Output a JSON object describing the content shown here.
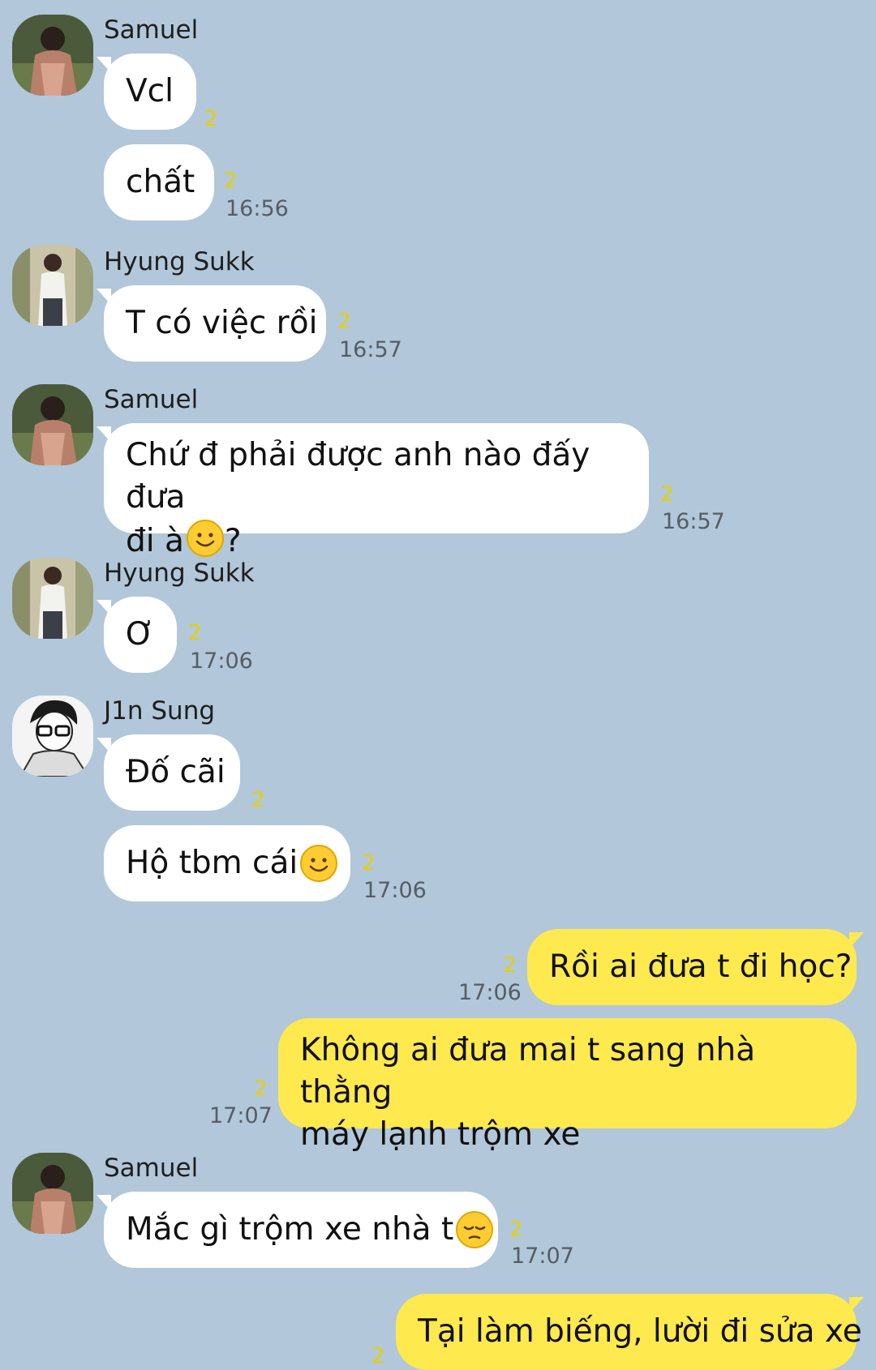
{
  "participants": {
    "samuel": "Samuel",
    "hyung_sukk": "Hyung Sukk",
    "j1n_sung": "J1n Sung"
  },
  "messages": [
    {
      "sender": "Samuel",
      "text": "Vcl",
      "unread": "2",
      "time": ""
    },
    {
      "sender": "",
      "text": "chất",
      "unread": "2",
      "time": "16:56"
    },
    {
      "sender": "Hyung Sukk",
      "text": "T có việc rồi",
      "unread": "2",
      "time": "16:57"
    },
    {
      "sender": "Samuel",
      "text_line1": "Chứ đ phải được anh nào đấy đưa",
      "text_line2_before": "đi à",
      "text_line2_after": "?",
      "emoji": "smile-emoji",
      "unread": "2",
      "time": "16:57"
    },
    {
      "sender": "Hyung Sukk",
      "text": "Ơ",
      "unread": "2",
      "time": "17:06"
    },
    {
      "sender": "J1n Sung",
      "text": "Đố cãi",
      "unread": "2",
      "time": ""
    },
    {
      "sender": "",
      "text": "Hộ tbm cái",
      "emoji": "smile-emoji",
      "unread": "2",
      "time": "17:06"
    },
    {
      "sender": "me",
      "text": "Rồi ai đưa t đi học?",
      "unread": "2",
      "time": "17:06"
    },
    {
      "sender": "me",
      "text_line1": "Không ai đưa mai t sang nhà thằng",
      "text_line2": "máy lạnh trộm xe",
      "unread": "2",
      "time": "17:07"
    },
    {
      "sender": "Samuel",
      "text": "Mắc gì trộm xe nhà t",
      "emoji": "pensive-emoji",
      "unread": "2",
      "time": "17:07"
    },
    {
      "sender": "me",
      "text": "Tại làm biếng, lười đi sửa xe",
      "unread": "2",
      "time": ""
    }
  ],
  "colors": {
    "background": "#b2c7d9",
    "incoming_bubble": "#ffffff",
    "outgoing_bubble": "#fee94e",
    "unread_count": "#e5d100",
    "timestamp": "#555d66"
  }
}
